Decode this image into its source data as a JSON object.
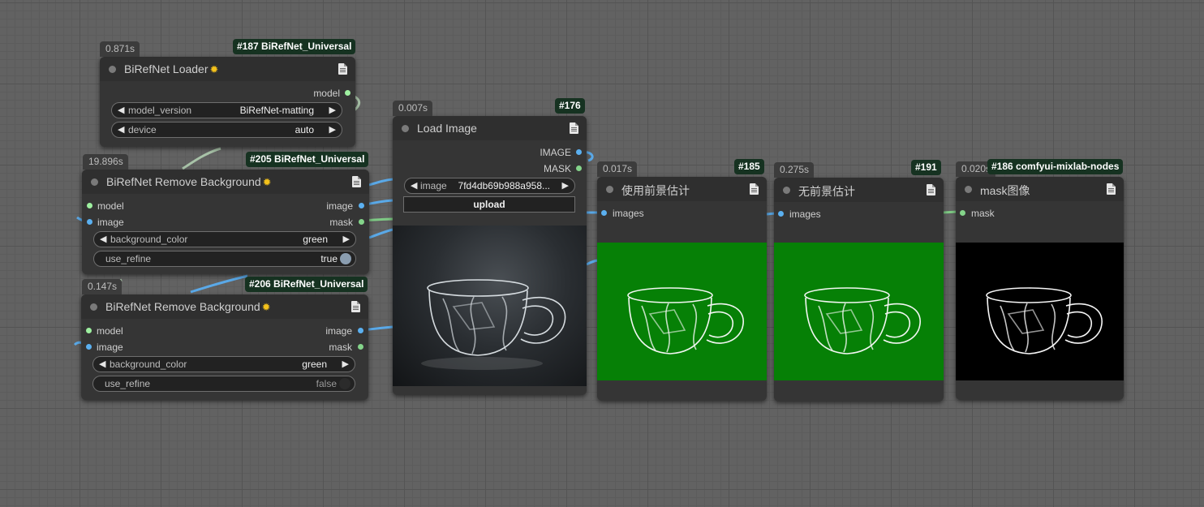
{
  "colors": {
    "image_slot": "#5bb0f0",
    "mask_slot": "#84d48a",
    "model_slot": "#9ef0a0",
    "wire_image": "#5aa9e8",
    "wire_mask": "#7ec984",
    "wire_model": "#a8c3a8",
    "green_bg": "#068006"
  },
  "nodes": {
    "loader": {
      "time": "0.871s",
      "id": "#187 BiRefNet_Universal",
      "title": "BiRefNet Loader",
      "icon": "sun-icon",
      "outputs": [
        "model"
      ],
      "widgets": [
        {
          "name": "model_version",
          "value": "BiRefNet-matting"
        },
        {
          "name": "device",
          "value": "auto"
        }
      ]
    },
    "remove_bg_205": {
      "time": "19.896s",
      "id": "#205 BiRefNet_Universal",
      "title": "BiRefNet Remove Background",
      "inputs": [
        "model",
        "image"
      ],
      "outputs": [
        "image",
        "mask"
      ],
      "widgets": [
        {
          "name": "background_color",
          "value": "green"
        },
        {
          "name": "use_refine",
          "value": "true"
        }
      ]
    },
    "remove_bg_206": {
      "time": "0.147s",
      "id": "#206 BiRefNet_Universal",
      "title": "BiRefNet Remove Background",
      "inputs": [
        "model",
        "image"
      ],
      "outputs": [
        "image",
        "mask"
      ],
      "widgets": [
        {
          "name": "background_color",
          "value": "green"
        },
        {
          "name": "use_refine",
          "value": "false"
        }
      ]
    },
    "load_image": {
      "time": "0.007s",
      "id": "#176",
      "title": "Load Image",
      "outputs": [
        "IMAGE",
        "MASK"
      ],
      "widgets": [
        {
          "name": "image",
          "value": "7fd4db69b988a958..."
        }
      ],
      "upload_label": "upload"
    },
    "preview_185": {
      "time": "0.017s",
      "id": "#185",
      "title": "使用前景估计",
      "inputs": [
        "images"
      ]
    },
    "preview_191": {
      "time": "0.275s",
      "id": "#191",
      "title": "无前景估计",
      "inputs": [
        "images"
      ]
    },
    "mask_186": {
      "time": "0.020s",
      "id": "#186 comfyui-mixlab-nodes",
      "title": "mask图像",
      "inputs": [
        "mask"
      ]
    }
  }
}
